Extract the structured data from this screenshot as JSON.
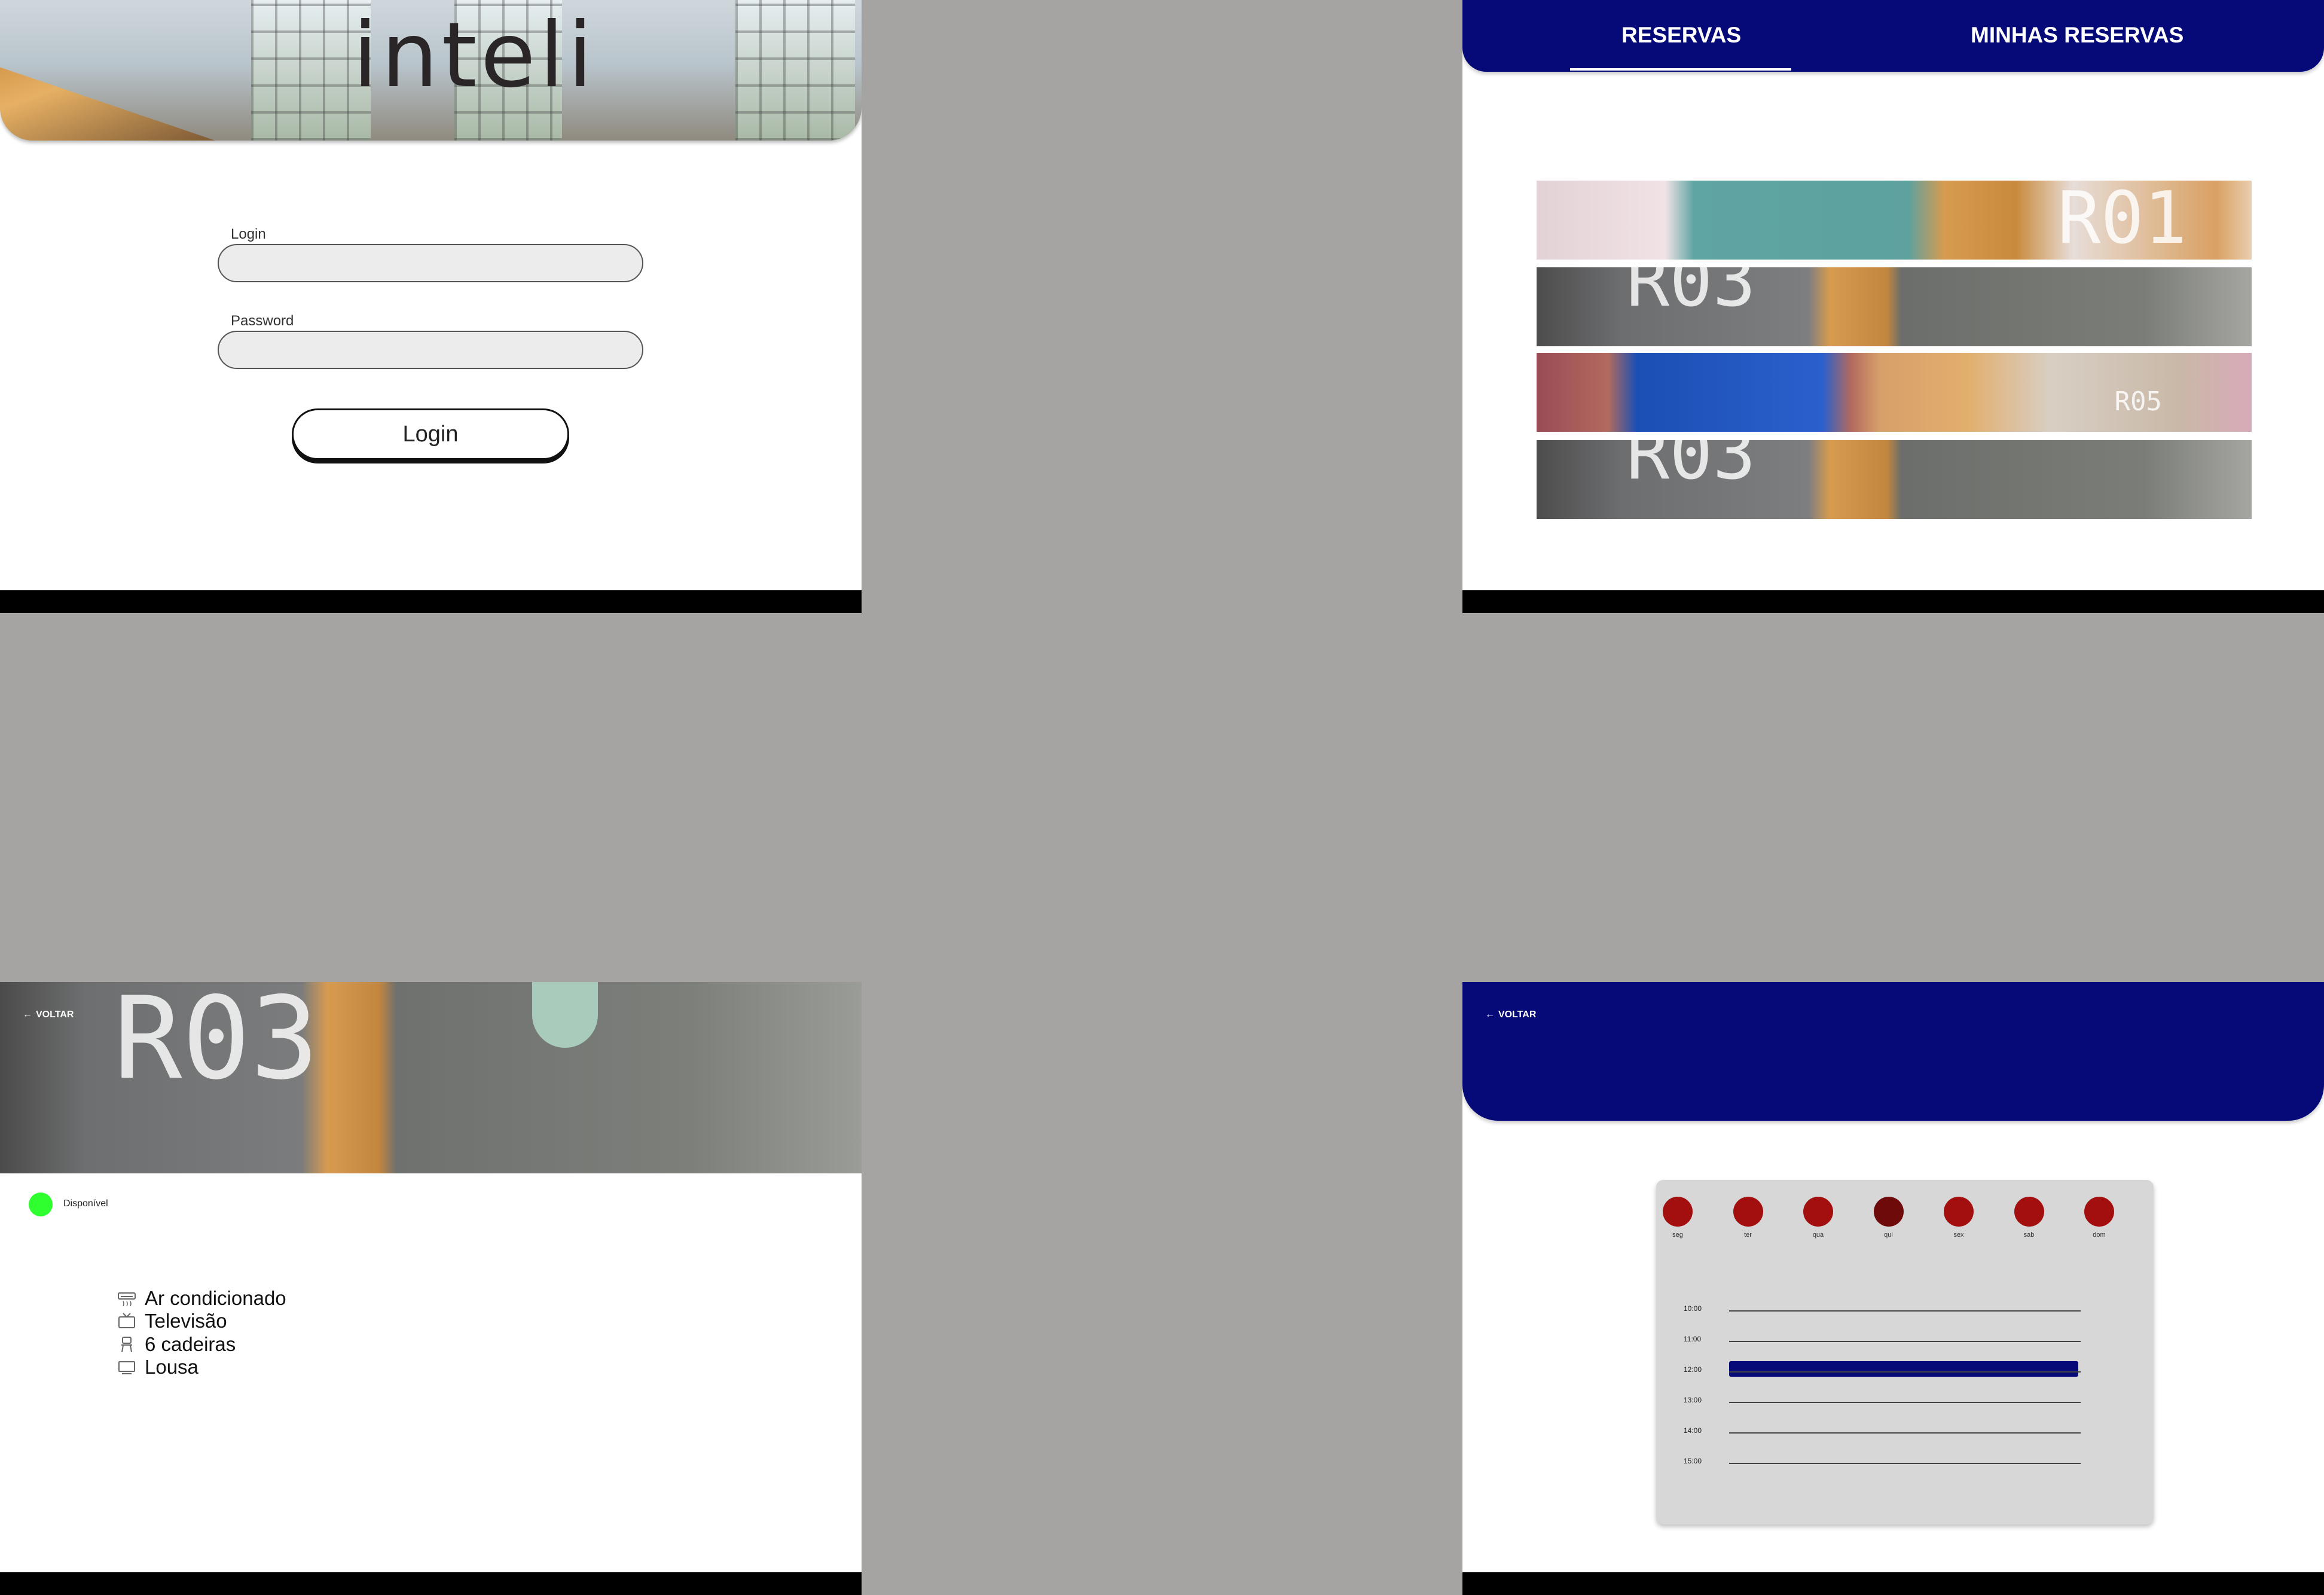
{
  "login": {
    "logo_text": "inteli",
    "login_label": "Login",
    "login_value": "",
    "password_label": "Password",
    "password_value": "",
    "button_label": "Login"
  },
  "rooms": {
    "tabs": [
      {
        "label": "RESERVAS",
        "active": true
      },
      {
        "label": "MINHAS RESERVAS",
        "active": false
      }
    ],
    "cards": [
      {
        "code": "R01"
      },
      {
        "code": "R03"
      },
      {
        "code": "R05"
      },
      {
        "code": "R03"
      }
    ]
  },
  "detail": {
    "back_label": "VOLTAR",
    "room_code": "R03",
    "status": {
      "text": "Disponível",
      "color": "#2fff2f"
    },
    "features": [
      {
        "icon": "air-conditioner-icon",
        "label": "Ar condicionado"
      },
      {
        "icon": "television-icon",
        "label": "Televisão"
      },
      {
        "icon": "chair-icon",
        "label": "6 cadeiras"
      },
      {
        "icon": "whiteboard-icon",
        "label": "Lousa"
      }
    ]
  },
  "schedule": {
    "back_label": "VOLTAR",
    "days": [
      {
        "label": "seg",
        "color": "#a30f0f"
      },
      {
        "label": "ter",
        "color": "#a30f0f"
      },
      {
        "label": "qua",
        "color": "#a30f0f"
      },
      {
        "label": "qui",
        "color": "#6f0a0a"
      },
      {
        "label": "sex",
        "color": "#a30f0f"
      },
      {
        "label": "sab",
        "color": "#a30f0f"
      },
      {
        "label": "dom",
        "color": "#a30f0f"
      }
    ],
    "times": [
      {
        "label": "10:00",
        "booked": false
      },
      {
        "label": "11:00",
        "booked": false
      },
      {
        "label": "12:00",
        "booked": true
      },
      {
        "label": "13:00",
        "booked": false
      },
      {
        "label": "14:00",
        "booked": false
      },
      {
        "label": "15:00",
        "booked": false
      }
    ]
  },
  "colors": {
    "brand_navy": "#050a78",
    "background_gray": "#a6a3a3",
    "available_green": "#2fff2f",
    "day_red": "#a30f0f"
  }
}
